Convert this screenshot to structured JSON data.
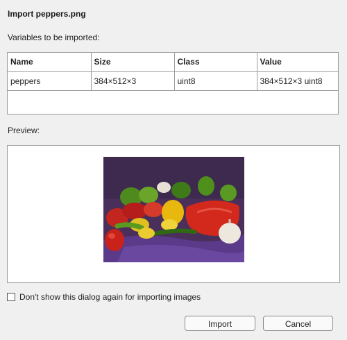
{
  "dialog": {
    "title": "Import peppers.png",
    "variables_label": "Variables to be imported:",
    "preview_label": "Preview:",
    "checkbox_label": "Don't show this dialog again for importing images",
    "checkbox_checked": false,
    "import_label": "Import",
    "cancel_label": "Cancel"
  },
  "table": {
    "headers": [
      "Name",
      "Size",
      "Class",
      "Value"
    ],
    "rows": [
      [
        "peppers",
        "384×512×3",
        "uint8",
        "384×512×3 uint8"
      ]
    ]
  },
  "preview": {
    "image_subject": "peppers"
  }
}
